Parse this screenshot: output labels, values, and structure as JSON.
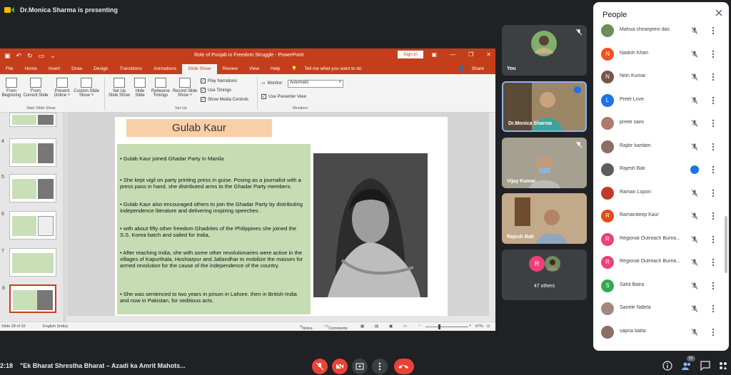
{
  "presenting": {
    "text": "Dr.Monica Sharma is presenting"
  },
  "ppt": {
    "window_title": "Role of Punjab in Freedom Struggle  -  PowerPoint",
    "sign_in": "Sign in",
    "tabs": [
      "File",
      "Home",
      "Insert",
      "Draw",
      "Design",
      "Transitions",
      "Animations",
      "Slide Show",
      "Review",
      "View",
      "Help"
    ],
    "tell_me": "Tell me what you want to do",
    "share": "Share",
    "ribbon": {
      "from_beginning": [
        "From",
        "Beginning"
      ],
      "from_current": [
        "From",
        "Current Slide"
      ],
      "present_online": [
        "Present",
        "Online ˅"
      ],
      "custom_show": [
        "Custom Slide",
        "Show ˅"
      ],
      "group_start": "Start Slide Show",
      "setup_show": [
        "Set Up",
        "Slide Show"
      ],
      "hide_slide": [
        "Hide",
        "Slide"
      ],
      "rehearse": [
        "Rehearse",
        "Timings"
      ],
      "record": [
        "Record Slide",
        "Show ˅"
      ],
      "play_narrations": "Play Narrations",
      "use_timings": "Use Timings",
      "show_media": "Show Media Controls",
      "group_setup": "Set Up",
      "monitor_label": "Monitor:",
      "monitor_value": "Automatic",
      "use_presenter": "Use Presenter View",
      "group_monitors": "Monitors"
    },
    "thumb_numbers": [
      "4",
      "5",
      "6",
      "7",
      "8"
    ],
    "slide": {
      "title": "Gulab Kaur",
      "bullets": [
        "•  Gulab Kaur joined Ghadar Party in Manila",
        "•  She kept vigil on party printing press in guise. Posing as a journalist with a press pass in hand, she distributed arms to the Ghadar Party members.",
        "•  Gulab Kaur also encouraged others to join the Ghadar Party by distributing independence literature and delivering inspiring speeches .",
        "•  with about fifty other freedom Ghadrites of the Philippines she joined the S.S. Korea batch and sailed for India,",
        "•  After reaching India, she with some other revolutionaries were active in the villages of Kapurthala, Hoshiarpur and Jallandhar to mobilize the masses for armed revolution for the cause of the independence of the country.",
        "•  She was sentenced to two years in prison in Lahore, then in British-India and now in Pakistan, for seditious acts."
      ]
    },
    "status": {
      "slide_of": "Slide 28 of 32",
      "language": "English (India)",
      "notes": "Notes",
      "comments": "Comments",
      "zoom": "67%"
    }
  },
  "tiles": [
    {
      "name": "You"
    },
    {
      "name": "Dr.Monica Sharma"
    },
    {
      "name": "Vijay Kumar"
    },
    {
      "name": "Rajesh Bali"
    },
    {
      "name": "47 others",
      "initial": "R"
    }
  ],
  "people": {
    "title": "People",
    "list": [
      {
        "name": "Mahua chiranjeevi das",
        "initial": "",
        "color": "#6b8e5a"
      },
      {
        "name": "Nadish Khan",
        "initial": "N",
        "color": "#f4511e"
      },
      {
        "name": "Nitin Kumar",
        "initial": "N",
        "color": "#795548"
      },
      {
        "name": "Preet Love",
        "initial": "L",
        "color": "#1a73e8"
      },
      {
        "name": "preeti saini",
        "initial": "",
        "color": "#b07a6a"
      },
      {
        "name": "Rajbir kardam",
        "initial": "",
        "color": "#8d6e63"
      },
      {
        "name": "Rajesh Bali",
        "initial": "",
        "color": "#5d5d5d"
      },
      {
        "name": "Raman Lopon",
        "initial": "",
        "color": "#c0392b"
      },
      {
        "name": "Ramandeep Kaur",
        "initial": "R",
        "color": "#e64a19"
      },
      {
        "name": "Regional Outreach Burea...",
        "initial": "R",
        "color": "#ec407a"
      },
      {
        "name": "Regional Outreach Burea...",
        "initial": "R",
        "color": "#ec407a"
      },
      {
        "name": "Sahil Batra",
        "initial": "S",
        "color": "#33a852"
      },
      {
        "name": "Sanele Ndlela",
        "initial": "",
        "color": "#a1887f"
      },
      {
        "name": "sapna batta",
        "initial": "",
        "color": "#8d6e63"
      }
    ]
  },
  "bottom": {
    "time": "2:18",
    "meeting": "\"Ek Bharat Shrestha Bharat – Azadi ka Amrit Mahots...",
    "people_count": "52"
  }
}
